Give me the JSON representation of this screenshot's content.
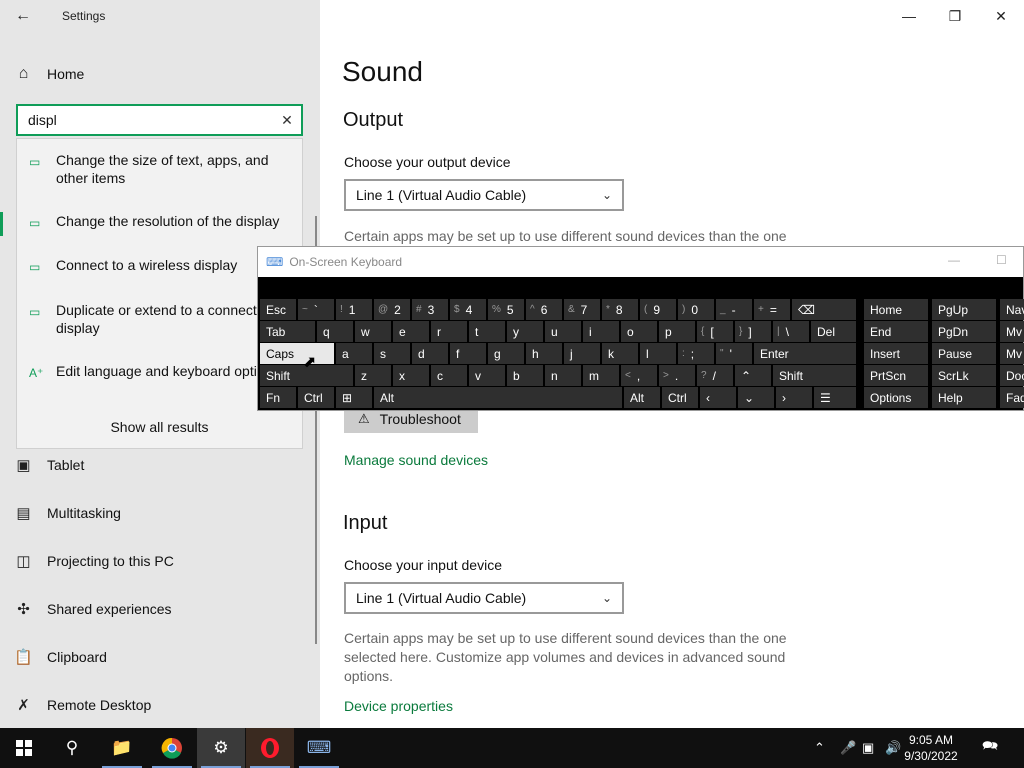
{
  "window": {
    "title": "Settings"
  },
  "sidebar": {
    "home": "Home",
    "search": {
      "value": "displ"
    },
    "suggestions": [
      "Change the size of text, apps, and other items",
      "Change the resolution of the display",
      "Connect to a wireless display",
      "Duplicate or extend to a connected display",
      "Edit language and keyboard options"
    ],
    "show_all": "Show all results",
    "items": [
      "Tablet",
      "Multitasking",
      "Projecting to this PC",
      "Shared experiences",
      "Clipboard",
      "Remote Desktop"
    ]
  },
  "main": {
    "title": "Sound",
    "output": {
      "heading": "Output",
      "label": "Choose your output device",
      "device": "Line 1 (Virtual Audio Cable)",
      "help": "Certain apps may be set up to use different sound devices than the one",
      "troubleshoot": "Troubleshoot",
      "manage": "Manage sound devices"
    },
    "input": {
      "heading": "Input",
      "label": "Choose your input device",
      "device": "Line 1 (Virtual Audio Cable)",
      "help": "Certain apps may be set up to use different sound devices than the one selected here. Customize app volumes and devices in advanced sound options.",
      "device_props": "Device properties"
    }
  },
  "osk": {
    "title": "On-Screen Keyboard",
    "keys": {
      "esc": "Esc",
      "tab": "Tab",
      "caps": "Caps",
      "shift": "Shift",
      "fn": "Fn",
      "ctrl": "Ctrl",
      "alt": "Alt",
      "del": "Del",
      "enter": "Enter",
      "shift_r": "Shift",
      "alt_r": "Alt",
      "ctrl_r": "Ctrl",
      "home": "Home",
      "pgup": "PgUp",
      "nav": "Nav",
      "end": "End",
      "pgdn": "PgDn",
      "mv1": "Mv",
      "insert": "Insert",
      "pause": "Pause",
      "mv2": "Mv",
      "prtscn": "PrtScn",
      "scrlk": "ScrLk",
      "dock": "Doc",
      "options": "Options",
      "help": "Help",
      "fade": "Fad"
    },
    "row1": [
      {
        "s": "~",
        "m": "`"
      },
      {
        "s": "!",
        "m": "1"
      },
      {
        "s": "@",
        "m": "2"
      },
      {
        "s": "#",
        "m": "3"
      },
      {
        "s": "$",
        "m": "4"
      },
      {
        "s": "%",
        "m": "5"
      },
      {
        "s": "^",
        "m": "6"
      },
      {
        "s": "&",
        "m": "7"
      },
      {
        "s": "*",
        "m": "8"
      },
      {
        "s": "(",
        "m": "9"
      },
      {
        "s": ")",
        "m": "0"
      },
      {
        "s": "_",
        "m": "-"
      },
      {
        "s": "+",
        "m": "="
      }
    ],
    "row2": [
      "q",
      "w",
      "e",
      "r",
      "t",
      "y",
      "u",
      "i",
      "o",
      "p"
    ],
    "row2b": [
      {
        "s": "{",
        "m": "["
      },
      {
        "s": "}",
        "m": "]"
      },
      {
        "s": "|",
        "m": "\\"
      }
    ],
    "row3": [
      "a",
      "s",
      "d",
      "f",
      "g",
      "h",
      "j",
      "k",
      "l"
    ],
    "row3b": [
      {
        "s": ":",
        "m": ";"
      },
      {
        "s": "\"",
        "m": "'"
      }
    ],
    "row4": [
      "z",
      "x",
      "c",
      "v",
      "b",
      "n",
      "m"
    ],
    "row4b": [
      {
        "s": "<",
        "m": ","
      },
      {
        "s": ">",
        "m": "."
      },
      {
        "s": "?",
        "m": "/"
      }
    ]
  },
  "taskbar": {
    "time": "9:05 AM",
    "date": "9/30/2022"
  }
}
